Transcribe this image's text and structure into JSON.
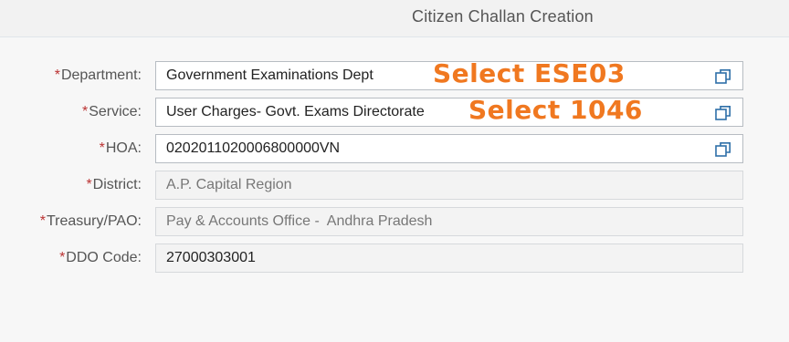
{
  "header": {
    "title": "Citizen Challan Creation"
  },
  "form": {
    "required_marker": "*",
    "department": {
      "label": "Department:",
      "value": "Government Examinations Dept",
      "icon": "value-help-icon"
    },
    "service": {
      "label": "Service:",
      "value": "User Charges- Govt. Exams Directorate",
      "icon": "value-help-icon"
    },
    "hoa": {
      "label": "HOA:",
      "value": "0202011020006800000VN",
      "icon": "value-help-icon"
    },
    "district": {
      "label": "District:",
      "value": "A.P. Capital Region"
    },
    "treasury": {
      "label": "Treasury/PAO:",
      "value": "Pay & Accounts Office -  Andhra Pradesh"
    },
    "ddo": {
      "label": "DDO Code:",
      "value": "27000303001"
    }
  },
  "annotations": {
    "department_hint": "Select ESE03",
    "service_hint": "Select 1046"
  },
  "colors": {
    "required": "#b33333",
    "annotation": "#f07820",
    "field_border": "#b7bcc2",
    "readonly_bg": "#f3f3f3"
  }
}
